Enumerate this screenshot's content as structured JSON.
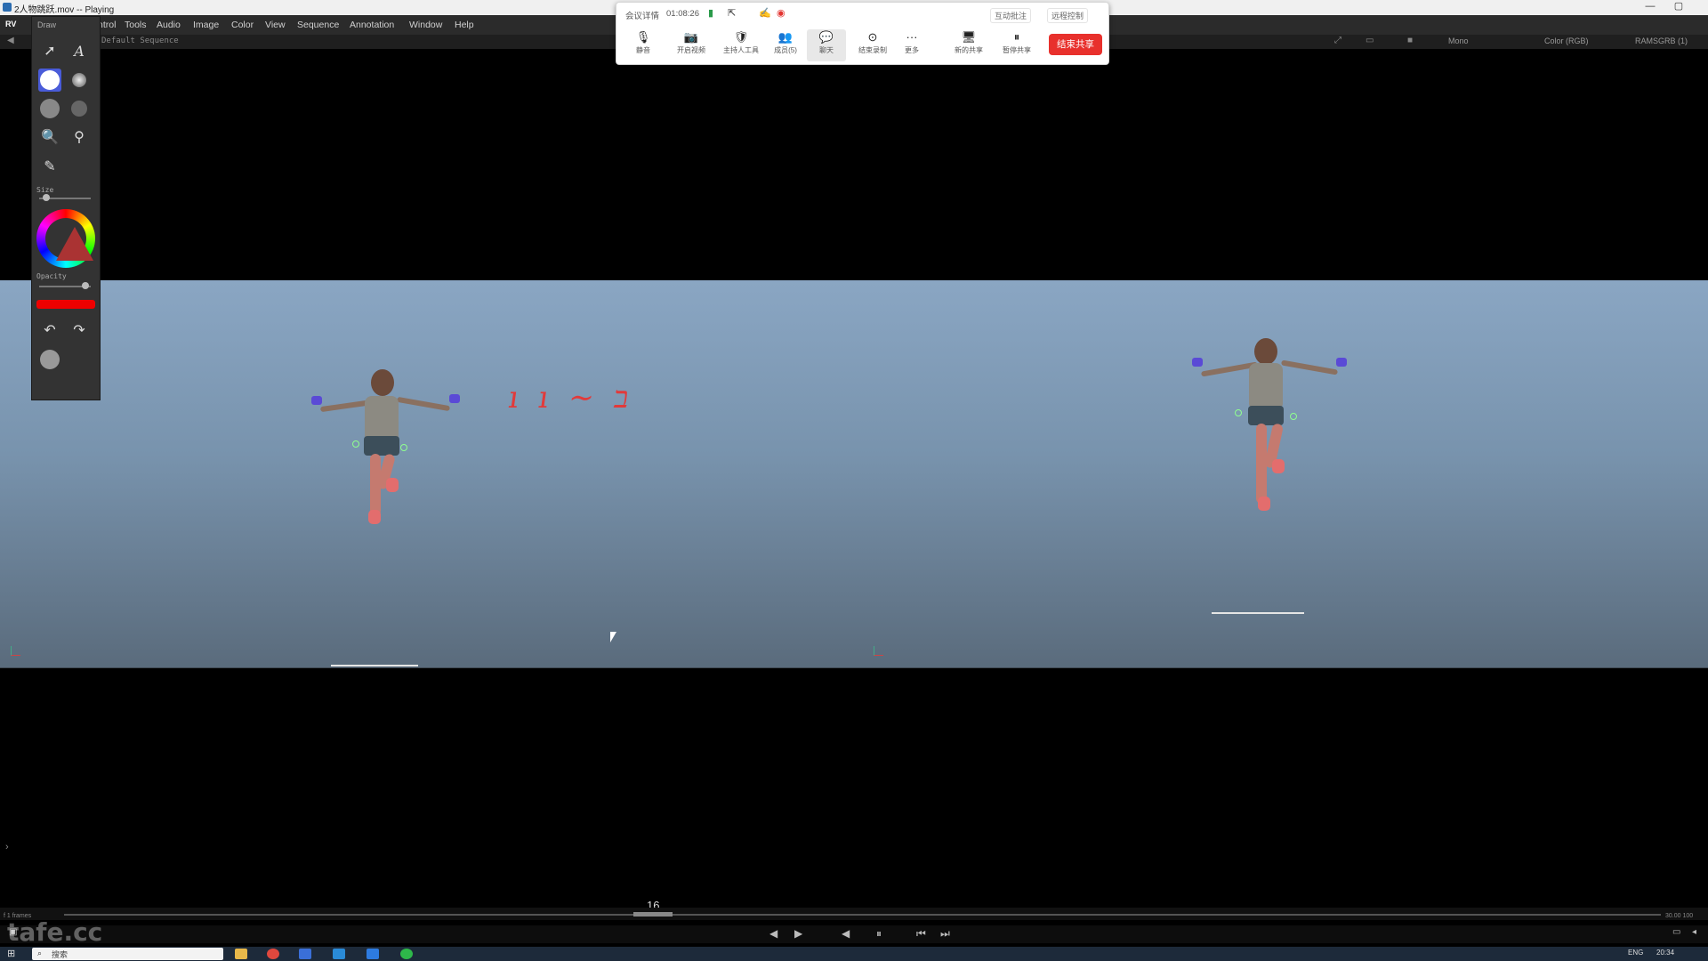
{
  "window": {
    "title": "2人物跳跃.mov -- Playing"
  },
  "menu": {
    "app_badge": "RV",
    "items": [
      "ntrol",
      "Tools",
      "Audio",
      "Image",
      "Color",
      "View",
      "Sequence",
      "Annotation",
      "Window",
      "Help"
    ]
  },
  "toolbar": {
    "sequence_label": "Default Sequence",
    "view_mode": "Mono",
    "color_mode": "Color (RGB)",
    "channel": "RAMSGRB (1)"
  },
  "meeting": {
    "details_label": "会议详情",
    "elapsed": "01:08:26",
    "topic_left": "互动批注",
    "topic_right": "远程控制",
    "buttons": [
      {
        "icon": "mic-icon",
        "glyph": "🎙",
        "label": "静音"
      },
      {
        "icon": "camera-icon",
        "glyph": "📷",
        "label": "开启视频"
      },
      {
        "icon": "shield-icon",
        "glyph": "🛡",
        "label": "主持人工具"
      },
      {
        "icon": "members-icon",
        "glyph": "👥",
        "label": "成员(5)"
      },
      {
        "icon": "chat-icon",
        "glyph": "💬",
        "label": "聊天"
      },
      {
        "icon": "record-icon",
        "glyph": "⊙",
        "label": "结束录制"
      },
      {
        "icon": "more-icon",
        "glyph": "···",
        "label": "更多"
      },
      {
        "icon": "new-share-icon",
        "glyph": "🖥",
        "label": "新的共享"
      },
      {
        "icon": "pause-share-icon",
        "glyph": "⏸",
        "label": "暂停共享"
      }
    ],
    "end_share_label": "结束共享"
  },
  "palette": {
    "title": "Draw",
    "size_label": "Size",
    "opacity_label": "Opacity",
    "current_color": "#e00000"
  },
  "viewport": {
    "annotation_text": "ı ı ~ ב"
  },
  "timeline": {
    "current_frame": "16",
    "left_label": "f 1 frames",
    "right_label": "30.00 100"
  },
  "taskbar": {
    "search_placeholder": "搜索",
    "time": "20:34",
    "lang": "ENG"
  },
  "watermark": "tafe.cc"
}
